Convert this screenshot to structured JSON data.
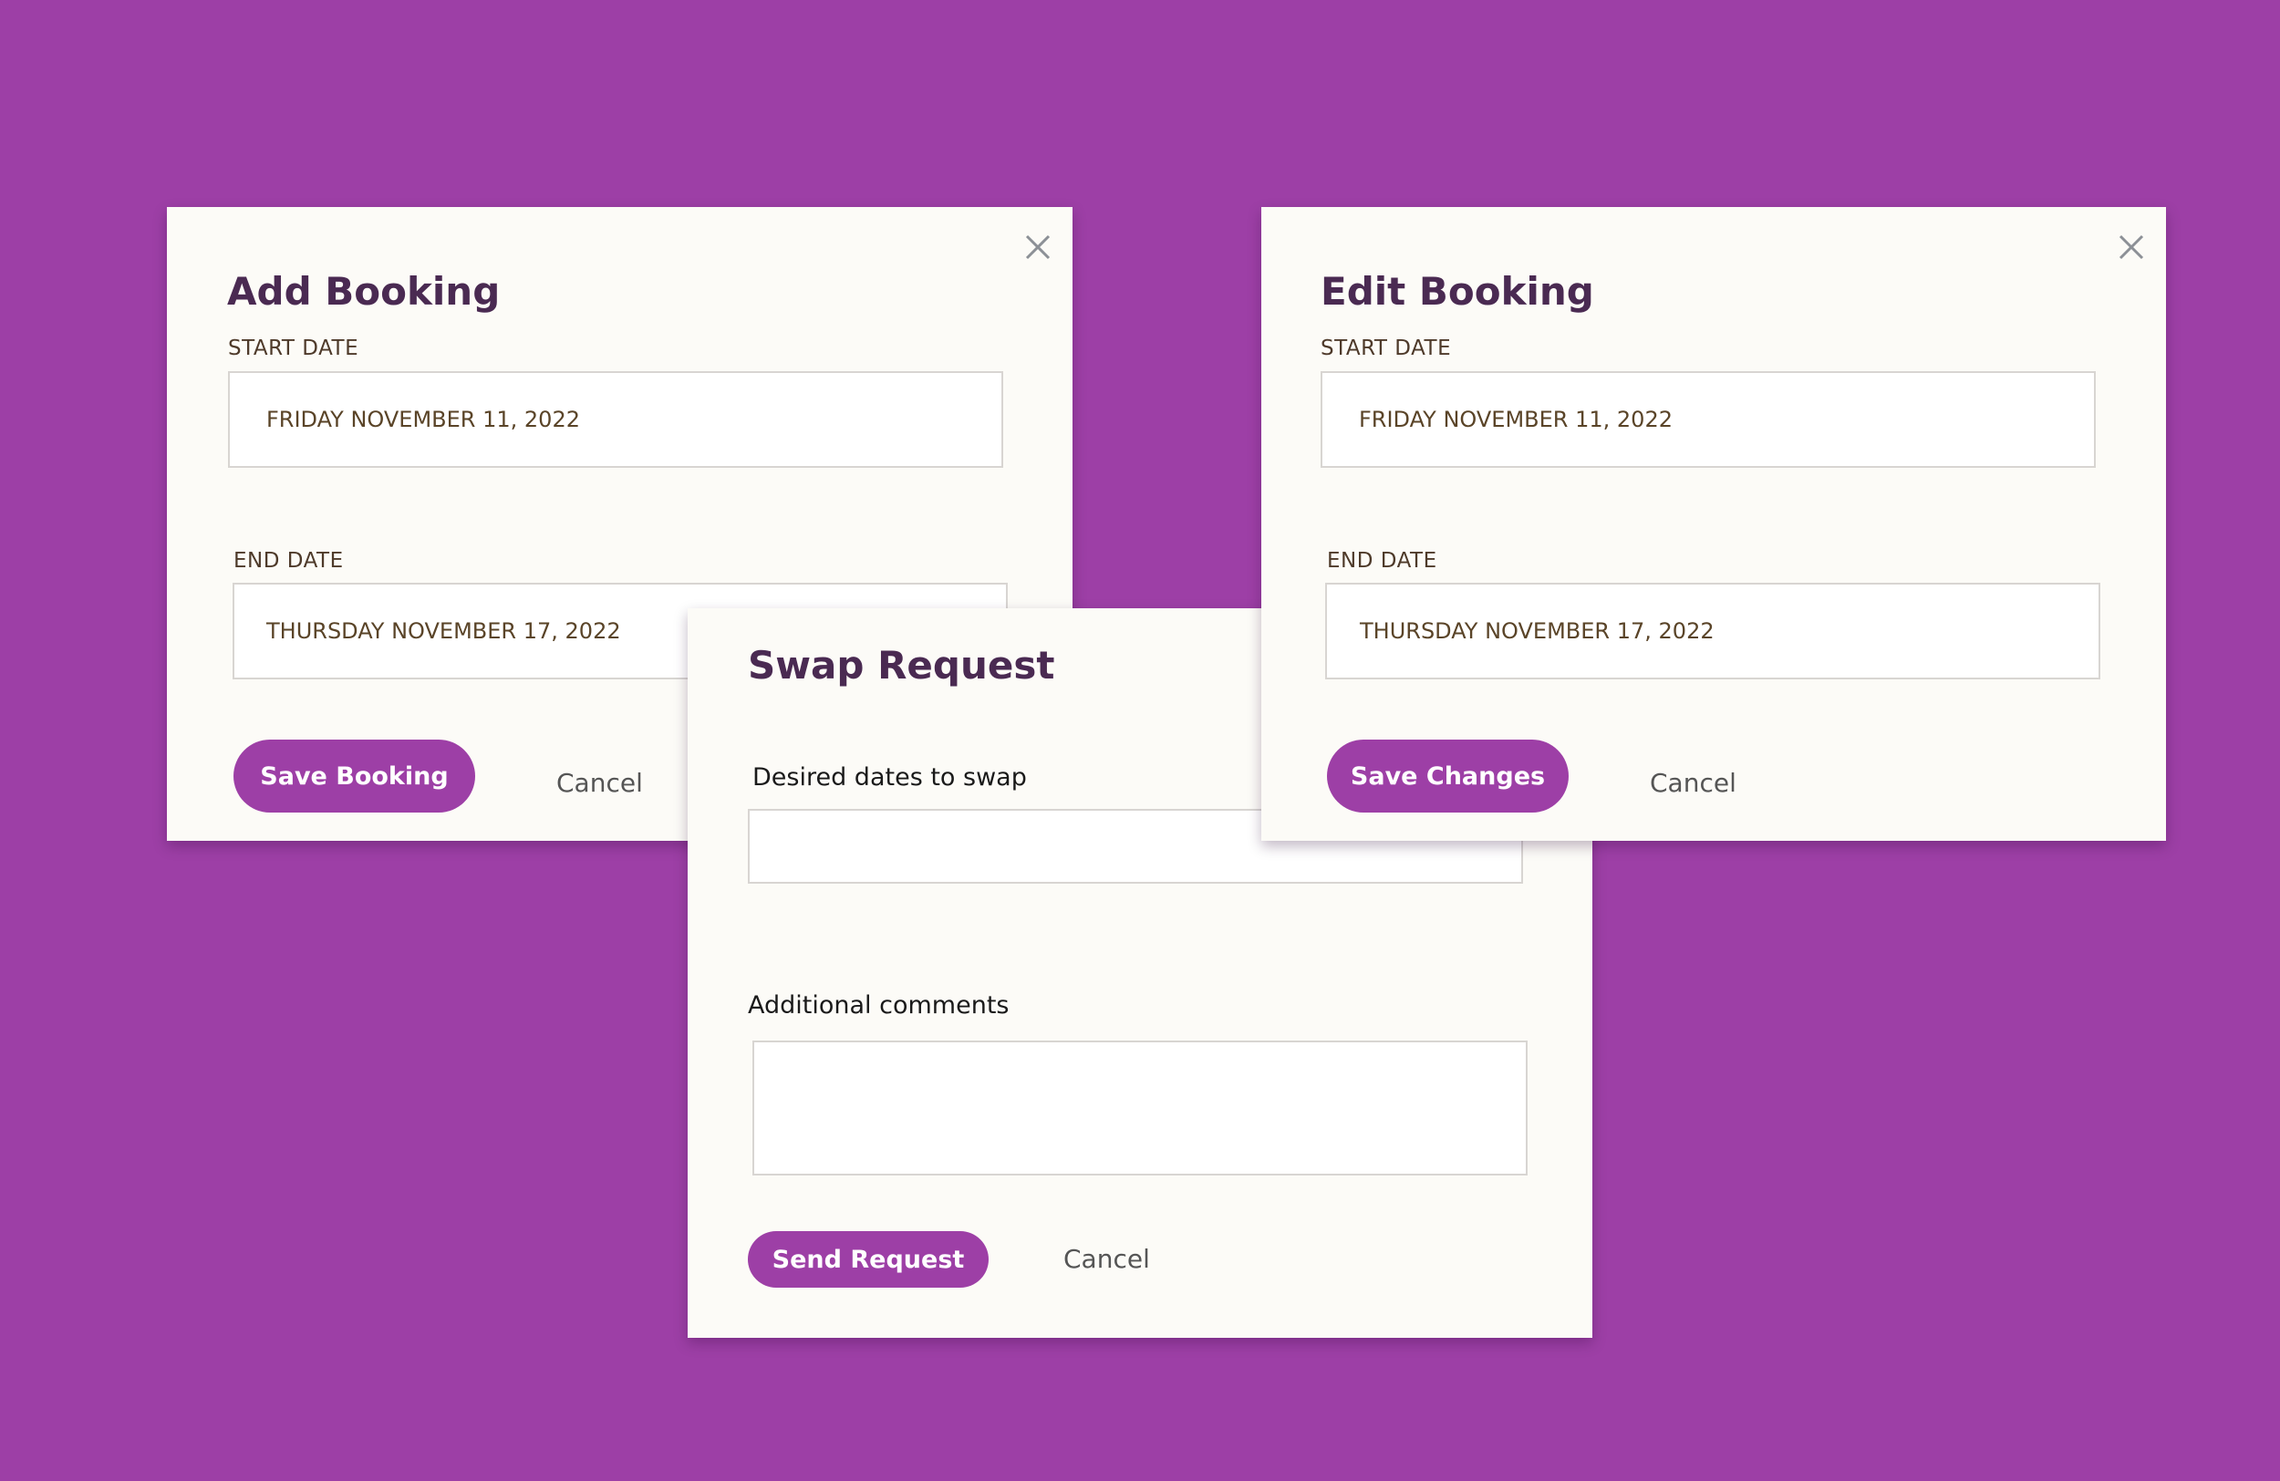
{
  "add_booking": {
    "title": "Add Booking",
    "start_date_label": "START DATE",
    "start_date_value": "FRIDAY NOVEMBER 11, 2022",
    "end_date_label": "END DATE",
    "end_date_value": "THURSDAY NOVEMBER 17, 2022",
    "save_label": "Save Booking",
    "cancel_label": "Cancel",
    "close_icon": "close-icon"
  },
  "edit_booking": {
    "title": "Edit Booking",
    "start_date_label": "START DATE",
    "start_date_value": "FRIDAY NOVEMBER 11, 2022",
    "end_date_label": "END DATE",
    "end_date_value": "THURSDAY NOVEMBER 17, 2022",
    "save_label": "Save Changes",
    "cancel_label": "Cancel",
    "close_icon": "close-icon"
  },
  "swap_request": {
    "title": "Swap Request",
    "desired_dates_label": "Desired dates to swap",
    "desired_dates_value": "",
    "comments_label": "Additional comments",
    "comments_value": "",
    "send_label": "Send Request",
    "cancel_label": "Cancel"
  },
  "colors": {
    "background": "#9d3fa6",
    "dialog_bg": "#fcfbf7",
    "title": "#4a2a52",
    "primary_button": "#9d3fa6"
  }
}
